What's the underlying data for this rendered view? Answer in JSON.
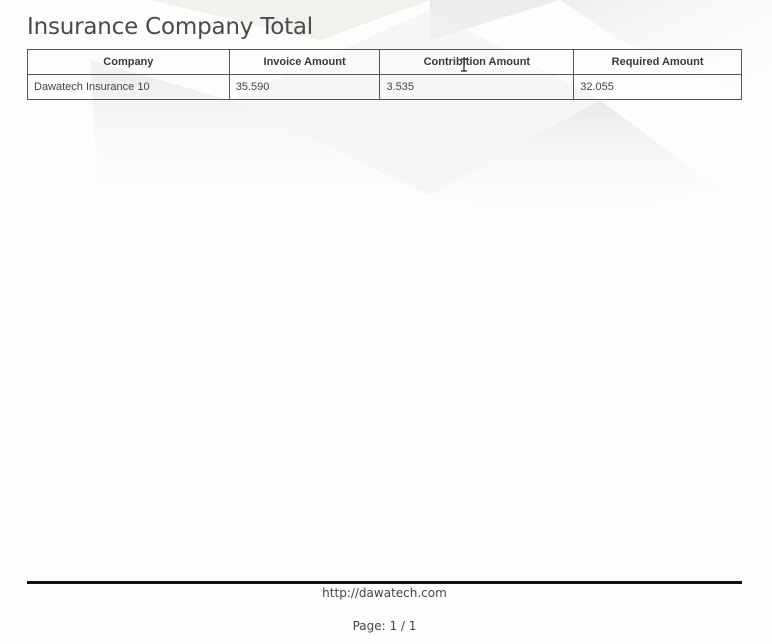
{
  "report": {
    "title": "Insurance Company Total"
  },
  "table": {
    "headers": [
      "Company",
      "Invoice Amount",
      "Contribition Amount",
      "Required Amount"
    ],
    "rows": [
      [
        "Dawatech Insurance 10",
        "35.590",
        "3.535",
        "32.055"
      ]
    ]
  },
  "footer": {
    "url": "http://dawatech.com",
    "page_label": "Page: 1 / 1"
  }
}
